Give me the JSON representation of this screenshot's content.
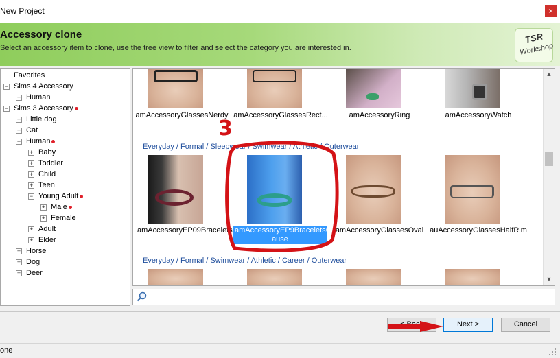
{
  "window": {
    "title": "New Project",
    "close_glyph": "×"
  },
  "header": {
    "title": "Accessory clone",
    "subtitle": "Select an accessory item to clone, use the tree view to filter and select the category you are interested in.",
    "logo_line1": "TSR",
    "logo_line2": "Workshop"
  },
  "tree": {
    "nodes": [
      {
        "label": "Favorites"
      },
      {
        "label": "Sims 4 Accessory"
      },
      {
        "label": "Human"
      },
      {
        "label": "Sims 3 Accessory"
      },
      {
        "label": "Little dog"
      },
      {
        "label": "Cat"
      },
      {
        "label": "Human"
      },
      {
        "label": "Baby"
      },
      {
        "label": "Toddler"
      },
      {
        "label": "Child"
      },
      {
        "label": "Teen"
      },
      {
        "label": "Young Adult"
      },
      {
        "label": "Male"
      },
      {
        "label": "Female"
      },
      {
        "label": "Adult"
      },
      {
        "label": "Elder"
      },
      {
        "label": "Horse"
      },
      {
        "label": "Dog"
      },
      {
        "label": "Deer"
      }
    ]
  },
  "gallery": {
    "row1": [
      "amAccessoryGlassesNerdy",
      "amAccessoryGlassesRect...",
      "amAccessoryRing",
      "amAccessoryWatch"
    ],
    "group1": "Everyday / Formal / Sleepwear / Swimwear / Athletic / Outerwear",
    "row2": [
      "amAccessoryEP09Bracelets",
      "amAccessoryEP9BraceletsCause",
      "amAccessoryGlassesOval",
      "auAccessoryGlassesHalfRim"
    ],
    "selected_line1": "amAccessoryEP9BraceletsC",
    "selected_line2": "ause",
    "group2": "Everyday / Formal / Swimwear / Athletic / Career / Outerwear"
  },
  "search": {
    "value": ""
  },
  "buttons": {
    "back": "< Back",
    "next": "Next >",
    "cancel": "Cancel"
  },
  "status": {
    "text": "one"
  },
  "annotation": {
    "step": "3"
  },
  "colors": {
    "annotation_red": "#d41216",
    "selection": "#3399ff",
    "header_green": "#8fcd5c"
  }
}
